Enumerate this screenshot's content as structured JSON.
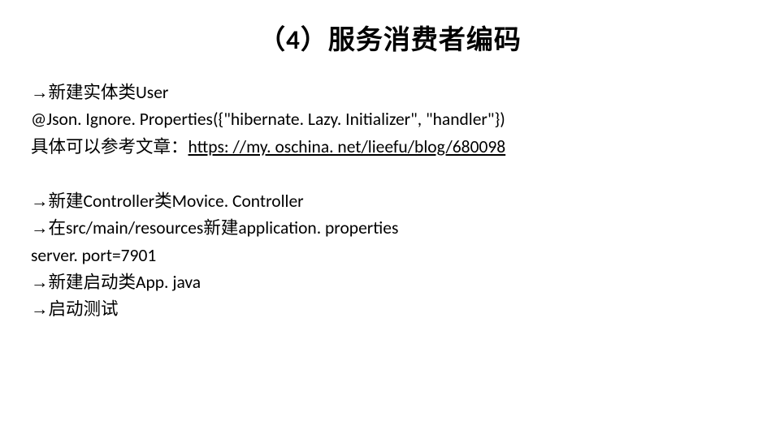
{
  "title": "（4）服务消费者编码",
  "p1_l1_pre": "新建实体类User",
  "p1_l2": "@Json. Ignore. Properties({\"hibernate. Lazy. Initializer\", \"handler\"})",
  "p1_l3_pre": "具体可以参考文章：",
  "p1_l3_link": "https: //my. oschina. net/lieefu/blog/680098",
  "p2_l1": "新建Controller类Movice. Controller",
  "p2_l2": "在src/main/resources新建application. properties",
  "p2_l3": "server. port=7901",
  "p2_l4": "新建启动类App. java",
  "p2_l5": "启动测试",
  "arrow": "→"
}
